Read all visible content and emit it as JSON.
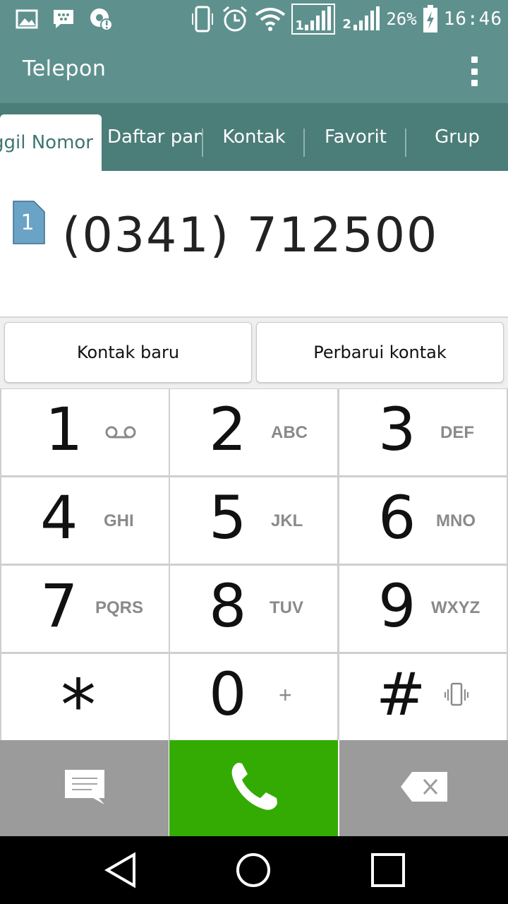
{
  "status_bar": {
    "icons_left": [
      "image-icon",
      "bbm-icon",
      "sync-alert-icon"
    ],
    "icons_right": [
      "vibrate-icon",
      "alarm-icon",
      "wifi-icon",
      "signal-sim1-icon",
      "signal-sim2-icon",
      "battery-charging-icon"
    ],
    "sim1_label": "1",
    "sim2_label": "2",
    "battery_percent": "26%",
    "time": "16:46"
  },
  "header": {
    "title": "Telepon",
    "menu_icon": "overflow-menu-icon"
  },
  "tabs": [
    {
      "label": "Panggil Nomor",
      "active": true
    },
    {
      "label": "Daftar panggilan",
      "active": false
    },
    {
      "label": "Kontak",
      "active": false
    },
    {
      "label": "Favorit",
      "active": false
    },
    {
      "label": "Grup",
      "active": false
    }
  ],
  "dialer": {
    "sim_label": "1",
    "number": "(0341) 712500"
  },
  "contact_buttons": {
    "new_contact": "Kontak baru",
    "update_contact": "Perbarui kontak"
  },
  "keypad": [
    {
      "digit": "1",
      "letters": "",
      "sub_icon": "voicemail-icon"
    },
    {
      "digit": "2",
      "letters": "ABC"
    },
    {
      "digit": "3",
      "letters": "DEF"
    },
    {
      "digit": "4",
      "letters": "GHI"
    },
    {
      "digit": "5",
      "letters": "JKL"
    },
    {
      "digit": "6",
      "letters": "MNO"
    },
    {
      "digit": "7",
      "letters": "PQRS"
    },
    {
      "digit": "8",
      "letters": "TUV"
    },
    {
      "digit": "9",
      "letters": "WXYZ"
    },
    {
      "digit": "*",
      "letters": ""
    },
    {
      "digit": "0",
      "letters": "+"
    },
    {
      "digit": "#",
      "letters": "",
      "sub_icon": "vibrate-icon"
    }
  ],
  "actions": {
    "message_icon": "message-icon",
    "call_icon": "phone-icon",
    "delete_icon": "backspace-icon",
    "call_color": "#34ab02"
  },
  "nav_bar": {
    "back_icon": "back-icon",
    "home_icon": "home-icon",
    "recents_icon": "recents-icon"
  },
  "colors": {
    "header_bg": "#5e918e",
    "tab_bg": "#4b7d79",
    "sim_badge": "#6aa3c5"
  }
}
